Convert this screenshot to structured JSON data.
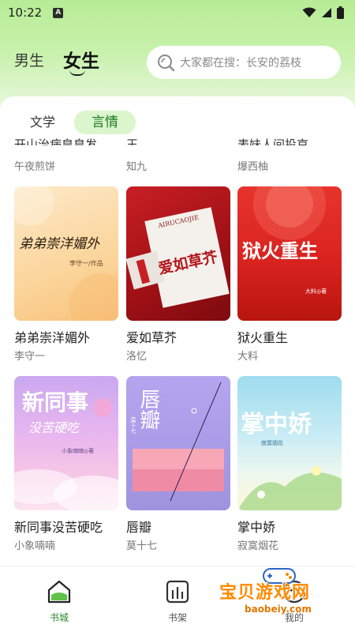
{
  "status": {
    "time": "10:22",
    "a_badge": "A"
  },
  "header": {
    "male_tab": "男生",
    "female_tab": "女生",
    "search_placeholder": "大家都在搜：长安的荔枝"
  },
  "subtabs": [
    "文学",
    "言情"
  ],
  "cut_row": [
    {
      "title": "开山治病皇皇发",
      "author": "午夜煎饼"
    },
    {
      "title": "王",
      "author": "知九"
    },
    {
      "title": "表妹人间投京",
      "author": "爆西柚"
    }
  ],
  "books": [
    {
      "title": "弟弟崇洋媚外",
      "author": "李守一",
      "cover_main": "弟弟崇洋媚外",
      "cover_sub": "李守一/作品"
    },
    {
      "title": "爱如草芥",
      "author": "洛忆",
      "cover_main": "爱如草芥",
      "cover_sub": "AIRUCAOJIE"
    },
    {
      "title": "狱火重生",
      "author": "大料",
      "cover_main": "狱火重生",
      "cover_sub": "大料◎著"
    },
    {
      "title": "新同事没苦硬吃",
      "author": "小象喃喃",
      "cover_main": "新同事",
      "cover_main2": "没苦硬吃",
      "cover_sub": "小象喃喃◎著"
    },
    {
      "title": "唇瓣",
      "author": "莫十七",
      "cover_main": "唇瓣",
      "cover_sub": "莫十七"
    },
    {
      "title": "掌中娇",
      "author": "寂寞烟花",
      "cover_main": "掌中娇",
      "cover_sub": "寂寞烟花"
    }
  ],
  "bottom_nav": [
    {
      "label": "书城",
      "active": true
    },
    {
      "label": "书架",
      "active": false
    },
    {
      "label": "我的",
      "active": false
    }
  ],
  "watermark": {
    "text": "宝贝游戏网",
    "url": "baobeiy.com"
  },
  "colors": {
    "accent": "#2e8b2e",
    "header_green": "#b7ec95",
    "tab_pill": "#dbf5cc"
  }
}
